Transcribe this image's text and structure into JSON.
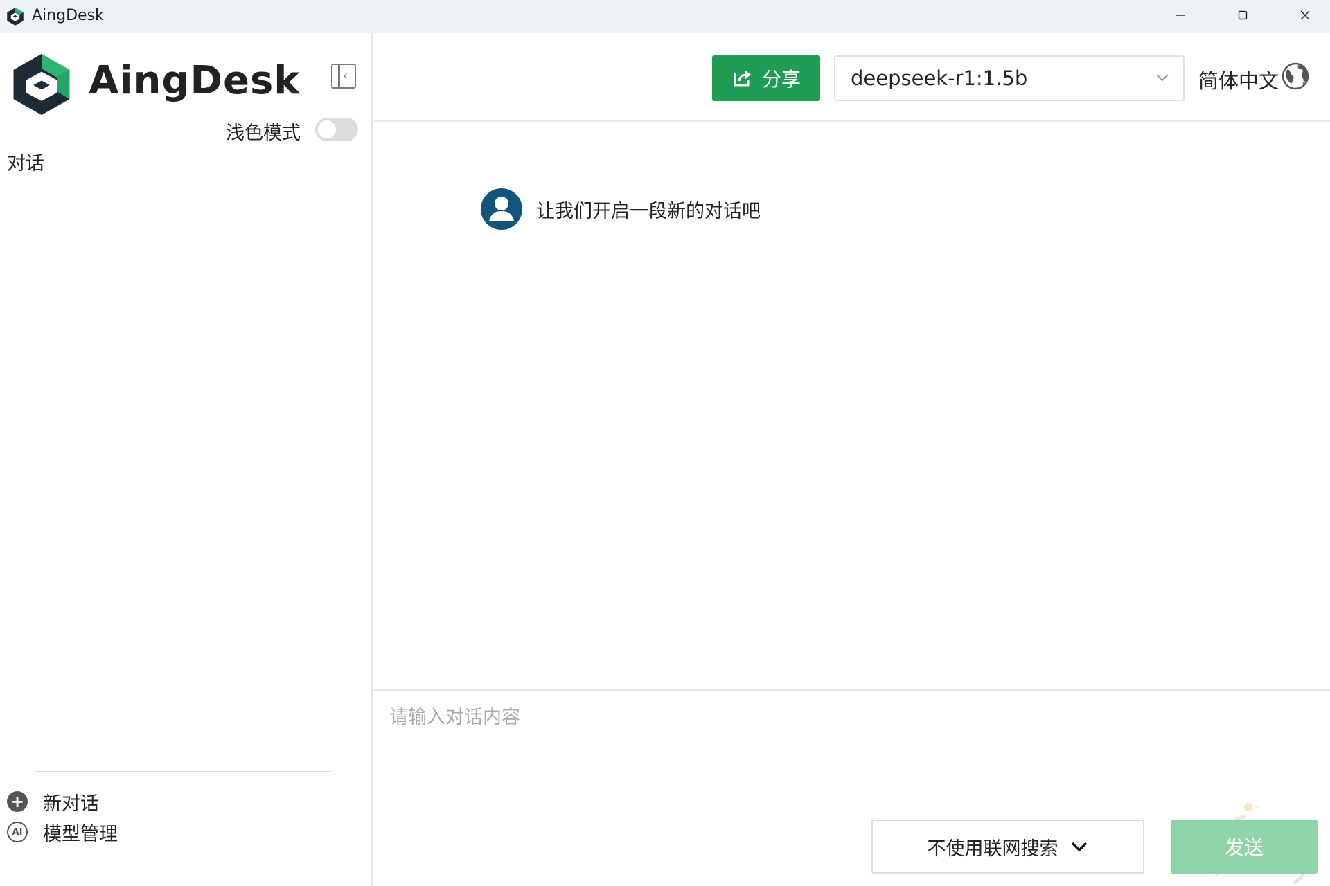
{
  "window": {
    "title": "AingDesk",
    "minimize_icon": "minimize-icon",
    "maximize_icon": "maximize-icon",
    "close_icon": "close-icon"
  },
  "sidebar": {
    "brand": "AingDesk",
    "theme_label": "浅色模式",
    "theme_toggle_on": false,
    "section_label": "对话",
    "bottom_items": [
      {
        "label": "新对话",
        "icon": "plus-circle-icon"
      },
      {
        "label": "模型管理",
        "icon": "ai-icon",
        "icon_text": "AI"
      }
    ]
  },
  "header": {
    "share_label": "分享",
    "model_value": "deepseek-r1:1.5b",
    "language_label": "简体中文"
  },
  "chat": {
    "welcome_message": "让我们开启一段新的对话吧"
  },
  "composer": {
    "placeholder": "请输入对话内容",
    "search_mode_label": "不使用联网搜索",
    "send_label": "发送"
  },
  "colors": {
    "accent": "#1f9d55",
    "send_disabled": "#8fd4a8",
    "avatar": "#12557a",
    "titlebar": "#eef2f7"
  }
}
